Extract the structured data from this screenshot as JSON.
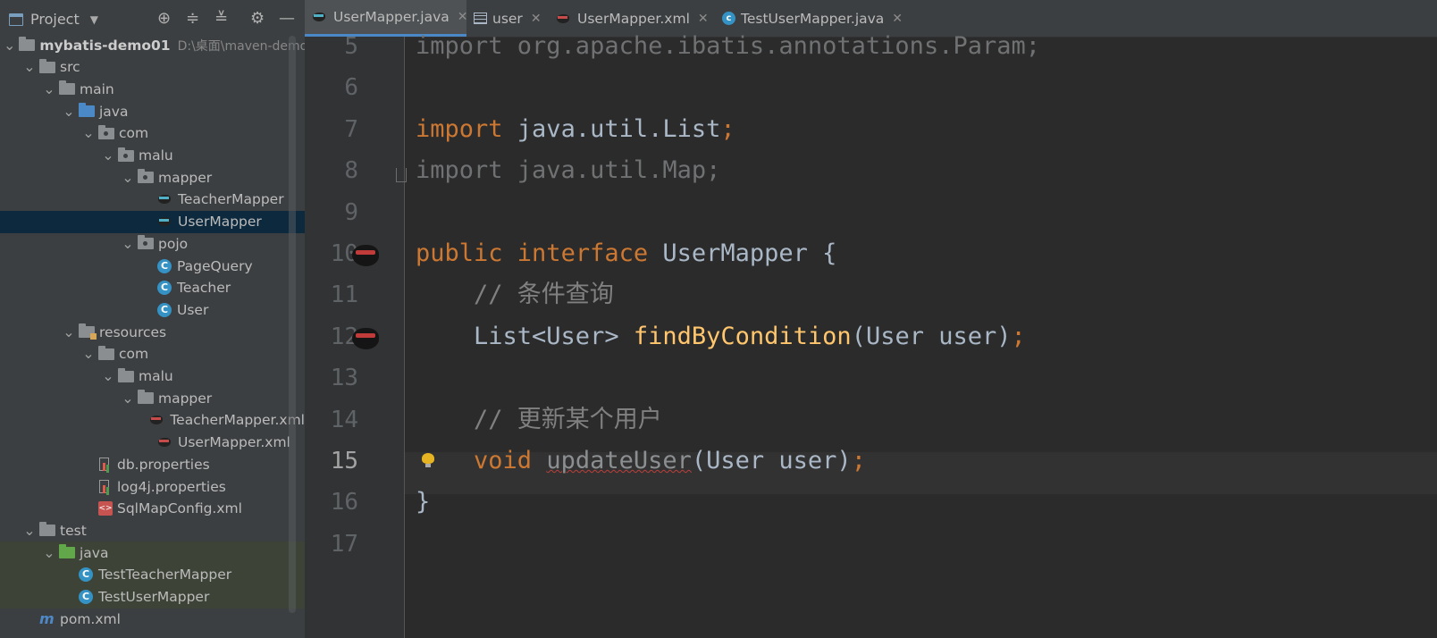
{
  "project_panel": {
    "title": "Project",
    "tree": [
      {
        "label": "mybatis-demo01",
        "path": "D:\\桌面\\maven-demo\\",
        "depth": 0,
        "arrow": "down",
        "icon": "module"
      },
      {
        "label": "src",
        "depth": 1,
        "arrow": "down",
        "icon": "folder"
      },
      {
        "label": "main",
        "depth": 2,
        "arrow": "down",
        "icon": "folder"
      },
      {
        "label": "java",
        "depth": 3,
        "arrow": "down",
        "icon": "source-folder"
      },
      {
        "label": "com",
        "depth": 4,
        "arrow": "down",
        "icon": "package"
      },
      {
        "label": "malu",
        "depth": 5,
        "arrow": "down",
        "icon": "package"
      },
      {
        "label": "mapper",
        "depth": 6,
        "arrow": "down",
        "icon": "package"
      },
      {
        "label": "TeacherMapper",
        "depth": 7,
        "icon": "mybatis-java"
      },
      {
        "label": "UserMapper",
        "depth": 7,
        "icon": "mybatis-java",
        "selected": true
      },
      {
        "label": "pojo",
        "depth": 6,
        "arrow": "down",
        "icon": "package"
      },
      {
        "label": "PageQuery",
        "depth": 7,
        "icon": "class"
      },
      {
        "label": "Teacher",
        "depth": 7,
        "icon": "class"
      },
      {
        "label": "User",
        "depth": 7,
        "icon": "class"
      },
      {
        "label": "resources",
        "depth": 3,
        "arrow": "down",
        "icon": "resources-folder"
      },
      {
        "label": "com",
        "depth": 4,
        "arrow": "down",
        "icon": "folder"
      },
      {
        "label": "malu",
        "depth": 5,
        "arrow": "down",
        "icon": "folder"
      },
      {
        "label": "mapper",
        "depth": 6,
        "arrow": "down",
        "icon": "folder"
      },
      {
        "label": "TeacherMapper.xml",
        "depth": 7,
        "icon": "mybatis-xml"
      },
      {
        "label": "UserMapper.xml",
        "depth": 7,
        "icon": "mybatis-xml"
      },
      {
        "label": "db.properties",
        "depth": 4,
        "icon": "properties"
      },
      {
        "label": "log4j.properties",
        "depth": 4,
        "icon": "properties"
      },
      {
        "label": "SqlMapConfig.xml",
        "depth": 4,
        "icon": "xml"
      },
      {
        "label": "test",
        "depth": 1,
        "arrow": "down",
        "icon": "folder"
      },
      {
        "label": "java",
        "depth": 2,
        "arrow": "down",
        "icon": "test-folder",
        "test": true
      },
      {
        "label": "TestTeacherMapper",
        "depth": 3,
        "icon": "test-class",
        "test": true
      },
      {
        "label": "TestUserMapper",
        "depth": 3,
        "icon": "test-class",
        "test": true
      },
      {
        "label": "pom.xml",
        "depth": 1,
        "icon": "maven"
      }
    ]
  },
  "tabs": [
    {
      "label": "UserMapper.java",
      "icon": "mybatis-java-icon",
      "active": true
    },
    {
      "label": "user",
      "icon": "table-icon"
    },
    {
      "label": "UserMapper.xml",
      "icon": "mybatis-xml-icon"
    },
    {
      "label": "TestUserMapper.java",
      "icon": "test-class-icon"
    }
  ],
  "editor": {
    "current_line": "15",
    "lines": [
      {
        "n": "5",
        "tokens": [
          {
            "t": "import org.apache.ibatis.annotations.Param;",
            "c": "dim"
          }
        ]
      },
      {
        "n": "6",
        "tokens": []
      },
      {
        "n": "7",
        "tokens": [
          {
            "t": "import ",
            "c": "kw"
          },
          {
            "t": "java.util.List",
            "c": ""
          },
          {
            "t": ";",
            "c": "kw"
          }
        ]
      },
      {
        "n": "8",
        "tokens": [
          {
            "t": "import java.util.Map;",
            "c": "dim"
          }
        ]
      },
      {
        "n": "9",
        "tokens": []
      },
      {
        "n": "10",
        "tokens": [
          {
            "t": "public ",
            "c": "kw"
          },
          {
            "t": "interface ",
            "c": "kw"
          },
          {
            "t": "UserMapper {",
            "c": ""
          }
        ],
        "gutter": "mybatis"
      },
      {
        "n": "11",
        "tokens": [
          {
            "t": "    // 条件查询",
            "c": "cm"
          }
        ]
      },
      {
        "n": "12",
        "tokens": [
          {
            "t": "    List<User> ",
            "c": ""
          },
          {
            "t": "findByCondition",
            "c": "fn"
          },
          {
            "t": "(User user)",
            "c": ""
          },
          {
            "t": ";",
            "c": "kw"
          }
        ],
        "gutter": "mybatis"
      },
      {
        "n": "13",
        "tokens": []
      },
      {
        "n": "14",
        "tokens": [
          {
            "t": "    // 更新某个用户",
            "c": "cm"
          }
        ]
      },
      {
        "n": "15",
        "tokens": [
          {
            "t": "    ",
            "c": ""
          },
          {
            "t": "void ",
            "c": "kw"
          },
          {
            "t": "updateUser",
            "c": "err"
          },
          {
            "t": "(User user)",
            "c": ""
          },
          {
            "t": ";",
            "c": "kw"
          }
        ],
        "gutter": "bulb"
      },
      {
        "n": "16",
        "tokens": [
          {
            "t": "}",
            "c": ""
          }
        ]
      },
      {
        "n": "17",
        "tokens": []
      }
    ]
  }
}
